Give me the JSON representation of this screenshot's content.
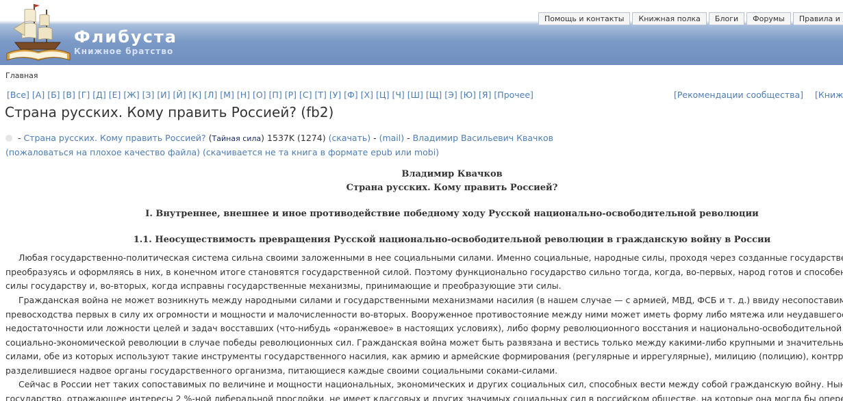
{
  "site": {
    "name": "Флибуста",
    "slogan": "Книжное братство"
  },
  "primary_links": [
    "Помощь и контакты",
    "Книжная полка",
    "Блоги",
    "Форумы",
    "Правила и ЧаВо"
  ],
  "breadcrumb": "Главная",
  "alphabet": [
    "[Все]",
    "[А]",
    "[Б]",
    "[В]",
    "[Г]",
    "[Д]",
    "[Е]",
    "[Ж]",
    "[З]",
    "[И]",
    "[Й]",
    "[К]",
    "[Л]",
    "[М]",
    "[Н]",
    "[О]",
    "[П]",
    "[Р]",
    "[С]",
    "[Т]",
    "[У]",
    "[Ф]",
    "[Х]",
    "[Ц]",
    "[Ч]",
    "[Ш]",
    "[Щ]",
    "[Э]",
    "[Ю]",
    "[Я]",
    "[Прочее]"
  ],
  "right_links": [
    "[Рекомендации сообщества]",
    "[Книжный"
  ],
  "page_title": "Страна русских. Кому править Россией? (fb2)",
  "book_line": {
    "prefix": " - ",
    "title": "Страна русских. Кому править Россией?",
    "genre_open": " (",
    "genre": "Тайная сила",
    "genre_close": ")",
    "size": " 1537K (1274) ",
    "download": "(скачать)",
    "sep1": " - ",
    "mail": "(mail)",
    "sep2": " - ",
    "author": "Владимир Васильевич Квачков"
  },
  "complain_line": {
    "complain": "(пожаловаться на плохое качество файла)",
    "wrong_format": "(скачивается не та книга в формате epub или mobi)"
  },
  "text": {
    "author": "Владимир Квачков",
    "book_title": "Страна русских. Кому править Россией?",
    "section": "I. Внутреннее, внешнее и иное противодействие победному ходу Русской национально-освободительной революции",
    "subsection": "1.1. Неосуществимость превращения Русской национально-освободительной революции в гражданскую войну в России",
    "para1": [
      "Любая государственно-политическая система сильна своими заложенными в нее социальными силами. Именно социальные, народные силы, проходя через созданные государственные",
      "преобразуясь и оформляясь в них, в конечном итоге становятся государственной силой. Поэтому функционально государство сильно тогда, когда, во-первых, народ готов и способен отд",
      "силы государству и, во-вторых, когда исправны государственные механизмы, принимающие и преобразующие эти силы."
    ],
    "para2": [
      "Гражданская война не может возникнуть между народными силами и государственными механизмами насилия (в нашем случае — с армией, МВД, ФСБ и т. д.) ввиду несопоставимого",
      "превосходства первых в силу их огромности и мощности и малочисленности во-вторых. Вооруженное противостояние между ними может иметь форму либо мятежа или неудавшегося вос",
      "недостаточности или ложности целей и задач восставших (что-нибудь «оранжевое» в настоящих условиях), либо форму революционного восстания и национально-освободительной и (",
      "социально-экономической революции в случае победы революционных сил. Гражданская война может быть развязана и вестись только между какими-либо крупными и значительными с",
      "силами, обе из которых используют такие инструменты государственного насилия, как армию и армейские формирования (регулярные и иррегулярные), милицию (полицию), контрразвед",
      "разделившиеся надвое органы государственного организма, питающиеся каждые своими социальными соками-силами."
    ],
    "para3": [
      "Сейчас в России нет таких сопоставимых по величине и мощности национальных, экономических и других социальных сил, способных вести между собой гражданскую войну. Нынешн",
      "государство, отражающее интересы 2 %-ной либеральной прослойки, не имеет классовых и других значимых социальных сил в российском обществе, на которые она могла бы опереться"
    ]
  },
  "colors": {
    "link": "#4d7db6",
    "header_blue": "#7c9ac7",
    "text": "#333333",
    "genre": "#1a2a6c"
  }
}
